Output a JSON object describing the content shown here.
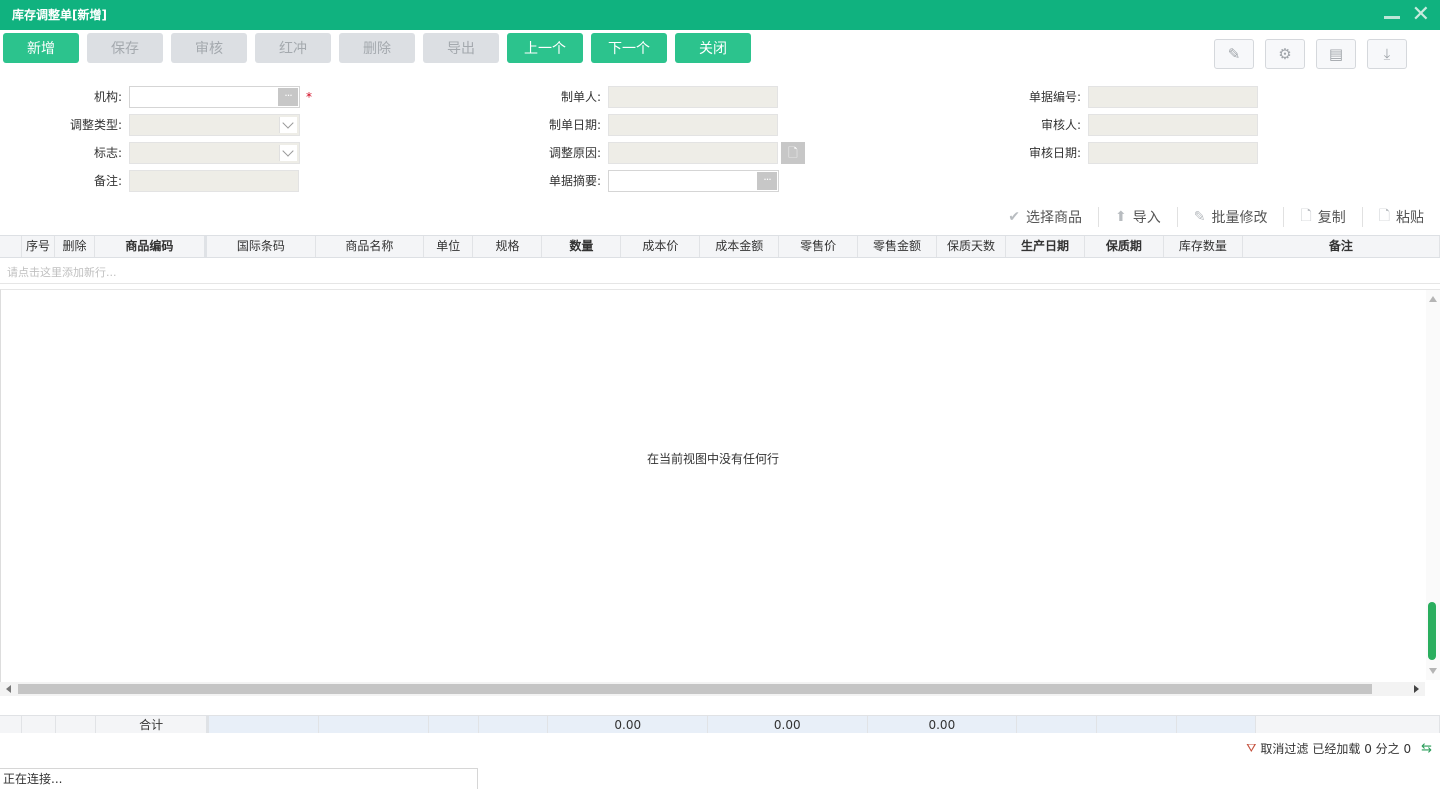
{
  "window": {
    "title": "库存调整单[新增]"
  },
  "toolbar": {
    "buttons": [
      {
        "label": "新增",
        "enabled": true
      },
      {
        "label": "保存",
        "enabled": false
      },
      {
        "label": "审核",
        "enabled": false
      },
      {
        "label": "红冲",
        "enabled": false
      },
      {
        "label": "删除",
        "enabled": false
      },
      {
        "label": "导出",
        "enabled": false
      },
      {
        "label": "上一个",
        "enabled": true
      },
      {
        "label": "下一个",
        "enabled": true
      },
      {
        "label": "关闭",
        "enabled": true
      }
    ],
    "right_icons": [
      "edit-icon",
      "gear-icon",
      "print-icon",
      "download-icon"
    ]
  },
  "form": {
    "org_label": "机构:",
    "org_required": "*",
    "adjust_type_label": "调整类型:",
    "flag_label": "标志:",
    "remark_label": "备注:",
    "creator_label": "制单人:",
    "create_date_label": "制单日期:",
    "reason_label": "调整原因:",
    "summary_label": "单据摘要:",
    "doc_no_label": "单据编号:",
    "auditor_label": "审核人:",
    "audit_date_label": "审核日期:",
    "ellipsis": "···"
  },
  "grid_tools": [
    {
      "label": "选择商品",
      "icon": "check-icon"
    },
    {
      "label": "导入",
      "icon": "arrow-up-icon"
    },
    {
      "label": "批量修改",
      "icon": "edit-icon"
    },
    {
      "label": "复制",
      "icon": "copy-icon"
    },
    {
      "label": "粘贴",
      "icon": "paste-icon"
    }
  ],
  "grid": {
    "columns": [
      "",
      "序号",
      "删除",
      "商品编码",
      "国际条码",
      "商品名称",
      "单位",
      "规格",
      "数量",
      "成本价",
      "成本金额",
      "零售价",
      "零售金额",
      "保质天数",
      "生产日期",
      "保质期",
      "库存数量",
      "备注"
    ],
    "add_row_hint": "请点击这里添加新行...",
    "empty_message": "在当前视图中没有任何行"
  },
  "footer": {
    "total_label": "合计",
    "quantity_total": "0.00",
    "cost_total": "0.00",
    "retail_total": "0.00"
  },
  "status": {
    "cancel_filter": "取消过滤",
    "loaded": "已经加载 0 分之 0",
    "connection": "正在连接..."
  }
}
